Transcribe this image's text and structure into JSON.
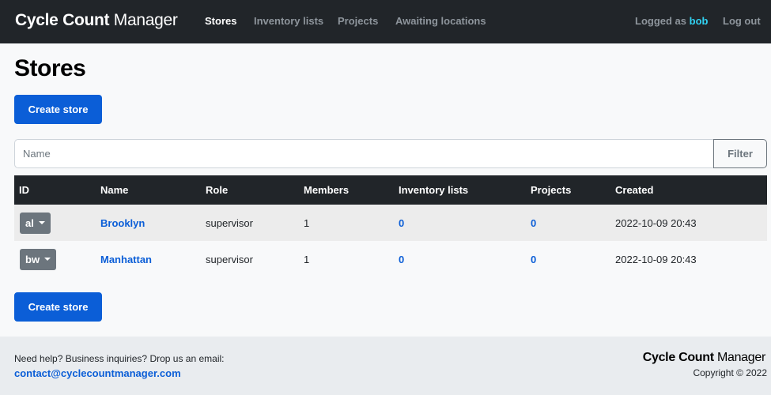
{
  "navbar": {
    "brand_bold": "Cycle Count",
    "brand_light": "Manager",
    "links": [
      {
        "label": "Stores",
        "active": true
      },
      {
        "label": "Inventory lists"
      },
      {
        "label": "Projects"
      },
      {
        "label": "Awaiting locations"
      }
    ],
    "logged_prefix": "Logged as",
    "username": "bob",
    "logout_label": "Log out"
  },
  "page": {
    "title": "Stores",
    "create_label": "Create store"
  },
  "filter": {
    "placeholder": "Name",
    "button_label": "Filter"
  },
  "table": {
    "columns": [
      "ID",
      "Name",
      "Role",
      "Members",
      "Inventory lists",
      "Projects",
      "Created"
    ],
    "rows": [
      {
        "id": "al",
        "name": "Brooklyn",
        "role": "supervisor",
        "members": "1",
        "inventory_lists": "0",
        "projects": "0",
        "created": "2022-10-09 20:43"
      },
      {
        "id": "bw",
        "name": "Manhattan",
        "role": "supervisor",
        "members": "1",
        "inventory_lists": "0",
        "projects": "0",
        "created": "2022-10-09 20:43"
      }
    ]
  },
  "footer": {
    "help_text": "Need help? Business inquiries? Drop us an email:",
    "email": "contact@cyclecountmanager.com",
    "brand_bold": "Cycle Count",
    "brand_light": "Manager",
    "copyright": "Copyright © 2022"
  },
  "colors": {
    "navbar_bg": "#212529",
    "primary": "#0b5ed7",
    "username": "#31d2f2",
    "id_badge": "#6c757d"
  }
}
